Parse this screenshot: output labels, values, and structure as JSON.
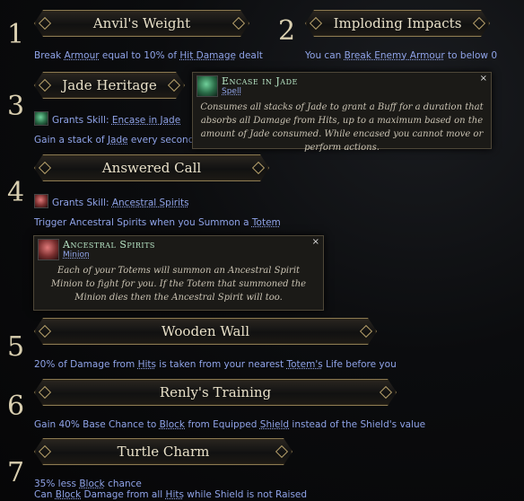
{
  "numbers": [
    "1",
    "2",
    "3",
    "4",
    "5",
    "6",
    "7"
  ],
  "items": [
    {
      "title": "Anvil's Weight",
      "desc_parts": [
        "Break ",
        "Armour",
        " equal to 10% of ",
        "Hit Damage",
        " dealt"
      ]
    },
    {
      "title": "Imploding Impacts",
      "desc_parts": [
        "You can ",
        "Break Enemy Armour",
        " to below 0"
      ]
    },
    {
      "title": "Jade Heritage",
      "grant_prefix": "Grants Skill: ",
      "grant_skill": "Encase in Jade",
      "desc_parts": [
        "Gain a stack of ",
        "Jade",
        " every second"
      ]
    },
    {
      "title": "Answered Call",
      "grant_prefix": "Grants Skill: ",
      "grant_skill": "Ancestral Spirits",
      "desc_parts": [
        "Trigger Ancestral Spirits when you Summon a ",
        "Totem"
      ]
    },
    {
      "title": "Wooden Wall",
      "desc_parts": [
        "20% of Damage from ",
        "Hits",
        " is taken from your nearest ",
        "Totem's",
        " Life before you"
      ]
    },
    {
      "title": "Renly's Training",
      "desc_parts": [
        "Gain 40% Base Chance to ",
        "Block",
        " from Equipped ",
        "Shield",
        " instead of the Shield's value"
      ]
    },
    {
      "title": "Turtle Charm",
      "desc_parts": [
        "35% less ",
        "Block",
        " chance"
      ],
      "desc2_parts": [
        "Can ",
        "Block",
        " Damage from all ",
        "Hits",
        " while Shield is not Raised"
      ]
    }
  ],
  "tooltips": [
    {
      "title": "Encase in Jade",
      "subtitle": "Spell",
      "close": "×",
      "body": "Consumes all stacks of Jade to grant a Buff for a duration that absorbs all Damage from Hits, up to a maximum based on the amount of Jade consumed. While encased you cannot move or perform actions."
    },
    {
      "title": "Ancestral Spirits",
      "subtitle": "Minion",
      "close": "×",
      "body": "Each of your Totems will summon an Ancestral Spirit Minion to fight for you. If the Totem that summoned the Minion dies then the Ancestral Spirit will too."
    }
  ]
}
